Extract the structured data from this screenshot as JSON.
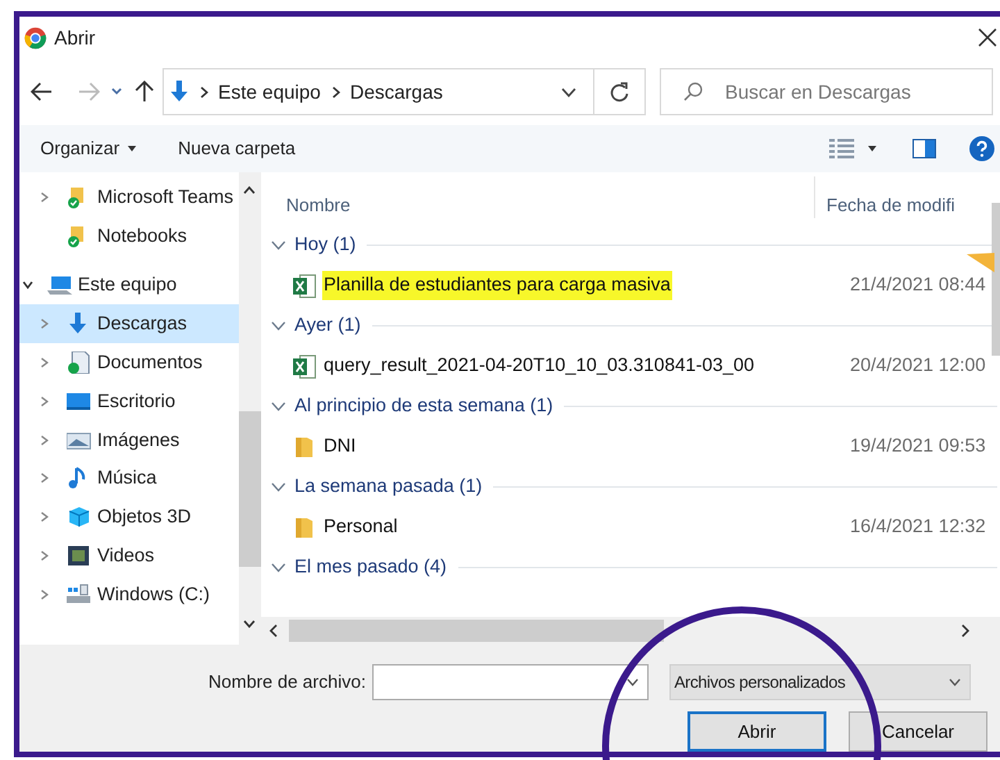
{
  "window": {
    "title": "Abrir"
  },
  "address": {
    "path": [
      "Este equipo",
      "Descargas"
    ],
    "search_placeholder": "Buscar en Descargas"
  },
  "toolbar": {
    "organize": "Organizar",
    "new_folder": "Nueva carpeta"
  },
  "sidebar": {
    "items": [
      {
        "label": "Microsoft Teams",
        "kind": "cloud-folder",
        "expandable": true,
        "selected": false
      },
      {
        "label": "Notebooks",
        "kind": "cloud-folder",
        "expandable": false,
        "selected": false
      },
      {
        "label": "Este equipo",
        "kind": "pc",
        "expandable": true,
        "expanded": true,
        "selected": false,
        "children": [
          {
            "label": "Descargas",
            "kind": "downloads",
            "expandable": true,
            "selected": true
          },
          {
            "label": "Documentos",
            "kind": "documents",
            "expandable": true,
            "selected": false
          },
          {
            "label": "Escritorio",
            "kind": "desktop",
            "expandable": true,
            "selected": false
          },
          {
            "label": "Imágenes",
            "kind": "pictures",
            "expandable": true,
            "selected": false
          },
          {
            "label": "Música",
            "kind": "music",
            "expandable": true,
            "selected": false
          },
          {
            "label": "Objetos 3D",
            "kind": "objects",
            "expandable": true,
            "selected": false
          },
          {
            "label": "Videos",
            "kind": "videos",
            "expandable": true,
            "selected": false
          },
          {
            "label": "Windows (C:)",
            "kind": "drive",
            "expandable": true,
            "selected": false
          }
        ]
      }
    ]
  },
  "file_list": {
    "columns": [
      "Nombre",
      "Fecha de modifi"
    ],
    "groups": [
      {
        "label": "Hoy (1)",
        "expanded": true,
        "files": [
          {
            "name": "Planilla de estudiantes para carga masiva",
            "date": "21/4/2021 08:44",
            "kind": "excel",
            "highlighted": true
          }
        ]
      },
      {
        "label": "Ayer (1)",
        "expanded": true,
        "files": [
          {
            "name": "query_result_2021-04-20T10_10_03.310841-03_00",
            "date": "20/4/2021 12:00",
            "kind": "excel",
            "highlighted": false
          }
        ]
      },
      {
        "label": "Al principio de esta semana (1)",
        "expanded": true,
        "files": [
          {
            "name": "DNI",
            "date": "19/4/2021 09:53",
            "kind": "folder",
            "highlighted": false
          }
        ]
      },
      {
        "label": "La semana pasada (1)",
        "expanded": true,
        "files": [
          {
            "name": "Personal",
            "date": "16/4/2021 12:32",
            "kind": "folder",
            "highlighted": false
          }
        ]
      },
      {
        "label": "El mes pasado (4)",
        "expanded": true
      }
    ]
  },
  "footer": {
    "filename_label": "Nombre de archivo:",
    "filter": "Archivos personalizados",
    "buttons": [
      {
        "label": "Abrir",
        "default": true
      },
      {
        "label": "Cancelar",
        "default": false
      }
    ]
  },
  "annotation": {
    "kind": "circle"
  }
}
